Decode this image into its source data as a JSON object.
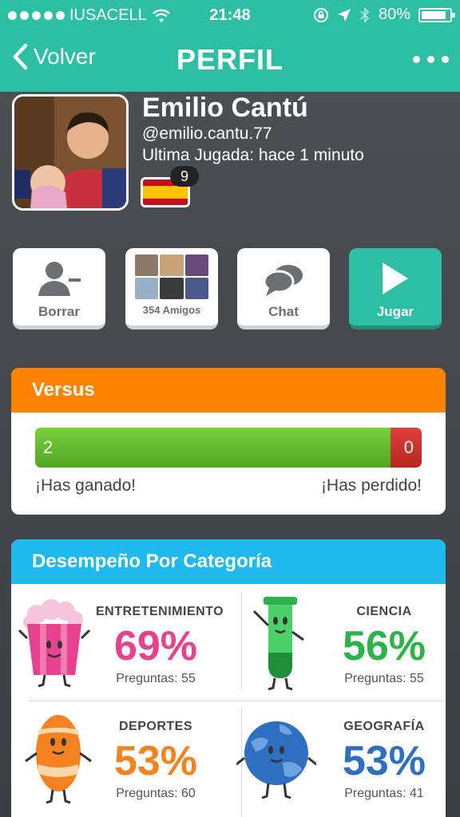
{
  "status_bar": {
    "carrier": "IUSACELL",
    "time": "21:48",
    "battery": "80%",
    "battery_level": 0.8
  },
  "nav": {
    "back_label": "Volver",
    "title": "PERFIL"
  },
  "profile": {
    "name": "Emilio Cantú",
    "handle": "@emilio.cantu.77",
    "last_played": "Ultima Jugada: hace 1 minuto",
    "country_badge": "9"
  },
  "actions": {
    "delete_label": "Borrar",
    "friends_label": "354 Amigos",
    "chat_label": "Chat",
    "play_label": "Jugar"
  },
  "versus": {
    "title": "Versus",
    "won_count": "2",
    "lost_count": "0",
    "won_label": "¡Has ganado!",
    "lost_label": "¡Has perdido!",
    "won_fraction": 0.92
  },
  "categories": {
    "title": "Desempeño Por Categoría",
    "items": [
      {
        "name": "ENTRETENIMIENTO",
        "percent": "69%",
        "questions": "Preguntas: 55",
        "color": "#e8418d",
        "icon": "popcorn-mascot-icon"
      },
      {
        "name": "CIENCIA",
        "percent": "56%",
        "questions": "Preguntas: 55",
        "color": "#2db34a",
        "icon": "test-tube-mascot-icon"
      },
      {
        "name": "DEPORTES",
        "percent": "53%",
        "questions": "Preguntas: 60",
        "color": "#f58220",
        "icon": "football-mascot-icon"
      },
      {
        "name": "GEOGRAFÍA",
        "percent": "53%",
        "questions": "Preguntas: 41",
        "color": "#2f6fc1",
        "icon": "globe-mascot-icon"
      }
    ]
  },
  "colors": {
    "header": "#2dbfa3",
    "versus": "#ff8200",
    "categories": "#1fb9ee"
  }
}
